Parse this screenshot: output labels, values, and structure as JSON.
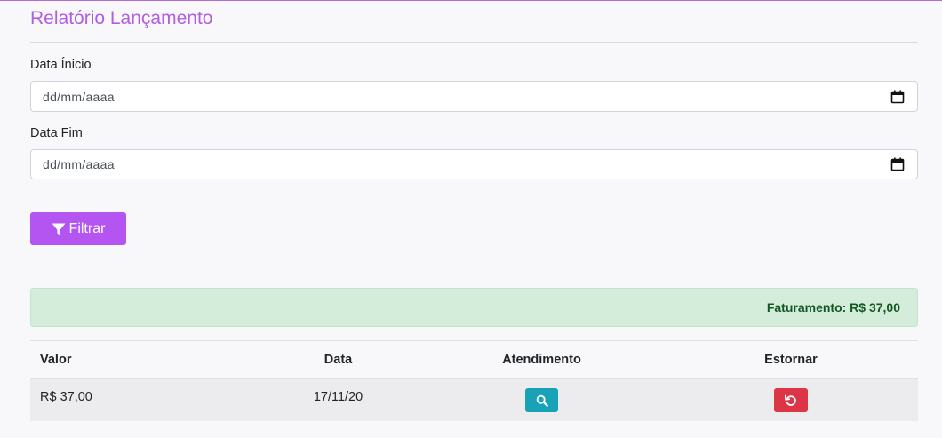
{
  "header": {
    "title": "Relatório Lançamento"
  },
  "form": {
    "start_label": "Data Ínicio",
    "start_placeholder": "dd/mm/aaaa",
    "end_label": "Data Fim",
    "end_placeholder": "dd/mm/aaaa",
    "filter_label": "Filtrar"
  },
  "summary": {
    "text": "Faturamento: R$ 37,00"
  },
  "table": {
    "headers": [
      "Valor",
      "Data",
      "Atendimento",
      "Estornar"
    ],
    "rows": [
      {
        "valor": "R$ 37,00",
        "data": "17/11/20"
      }
    ]
  },
  "icons": {
    "filter": "filter-icon",
    "calendar": "calendar-icon",
    "search": "search-icon",
    "undo": "undo-icon"
  },
  "colors": {
    "accent": "#b455f2",
    "title": "#b15ee0",
    "success_bg": "#d4edda",
    "success_text": "#155724",
    "info": "#17a2b8",
    "danger": "#dc3545"
  }
}
